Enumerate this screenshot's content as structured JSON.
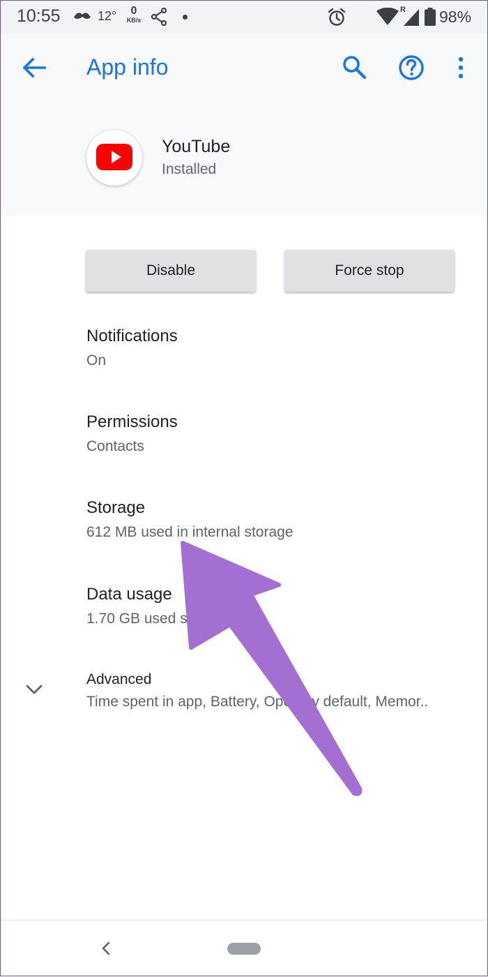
{
  "status_bar": {
    "time": "10:55",
    "temperature": "12°",
    "network_speed": "0",
    "network_speed_unit": "KB/s",
    "roaming_indicator": "R",
    "battery": "98%",
    "icons": [
      "mustache-icon",
      "share-icon",
      "dot-icon",
      "alarm-icon",
      "wifi-icon",
      "signal-icon",
      "battery-icon"
    ]
  },
  "header": {
    "title": "App info",
    "accent_color": "#1a73e8",
    "icons": [
      "back-arrow-icon",
      "search-icon",
      "help-icon",
      "more-vert-icon"
    ]
  },
  "app": {
    "name": "YouTube",
    "status": "Installed",
    "icon": "youtube-icon"
  },
  "actions": {
    "disable_label": "Disable",
    "force_stop_label": "Force stop"
  },
  "settings": {
    "notifications": {
      "title": "Notifications",
      "subtitle": "On"
    },
    "permissions": {
      "title": "Permissions",
      "subtitle": "Contacts"
    },
    "storage": {
      "title": "Storage",
      "subtitle": "612 MB used in internal storage"
    },
    "data_usage": {
      "title": "Data usage",
      "subtitle": "1.70 GB used since Jun 27"
    },
    "advanced": {
      "title": "Advanced",
      "subtitle": "Time spent in app, Battery, Open by default, Memor.."
    }
  },
  "annotation": {
    "type": "arrow",
    "color": "#a46fd3",
    "points_to": "storage"
  },
  "nav_bar": {
    "icons": [
      "nav-back-icon",
      "nav-home-pill"
    ]
  }
}
